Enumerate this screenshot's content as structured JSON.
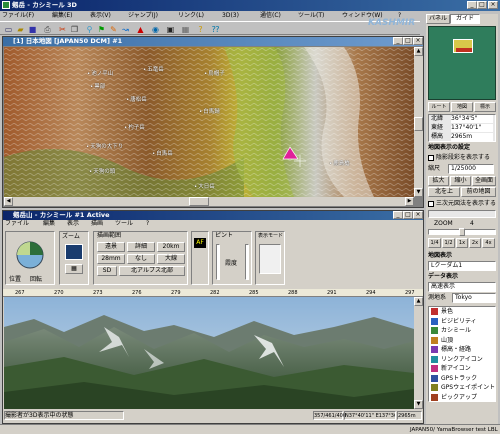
{
  "window": {
    "title": "剱岳 - カシミール 3D"
  },
  "menu": [
    "ファイル(F)",
    "編集(E)",
    "表示(V)",
    "ジャンプ(J)",
    "リンク(L)",
    "3D(3)",
    "通信(C)",
    "ツール(T)",
    "ウィンドウ(W)",
    "?"
  ],
  "brand": {
    "name": "KASHMIR 3D"
  },
  "map_window": {
    "title": "[1] 日本地図 [JAPAN50 DCM] #1",
    "places": [
      "池ノ平山",
      "五竜岳",
      "黒部",
      "唐松岳",
      "烏帽子",
      "白馬鑓",
      "杓子岳",
      "天狗の大下り",
      "白馬岳",
      "天狗の頭",
      "大日岳",
      "鹿島槍"
    ]
  },
  "scene_window": {
    "title": "剱岳山 - カシミール #1 Active",
    "menu": [
      "ファイル",
      "編集",
      "表示",
      "描画",
      "ツール",
      "?"
    ],
    "groups": {
      "view_label": "位置",
      "view2_label": "回転",
      "zoom_label": "ズーム",
      "range_label": "描画範囲",
      "buttons": [
        "遠景",
        "詳細",
        "20km",
        "28mm",
        "なし",
        "大線",
        "SD",
        "北アルプス北部"
      ],
      "mode_btn": "AF",
      "aux_btns": [
        "ピント",
        "霞度"
      ],
      "opt_label": "表示モード"
    },
    "ruler": [
      "267",
      "270",
      "273",
      "276",
      "279",
      "282",
      "285",
      "288",
      "291",
      "294",
      "297"
    ],
    "status": [
      "撮影者が3D表示中の状態",
      "357/461/400",
      "N37°40'11\" E137°36'38\"",
      "2965m"
    ]
  },
  "right_panel": {
    "tabs": [
      "パネル",
      "ガイド"
    ],
    "mode_tabs": [
      "ルート",
      "地図",
      "標示"
    ],
    "info_rows": [
      [
        "北緯",
        "36°34'5\""
      ],
      [
        "東経",
        "137°40'1\""
      ],
      [
        "標高",
        "2965m"
      ]
    ],
    "section1": "地図表示の設定",
    "check1": "陰影段彩を表示する",
    "scale_label": "縮尺",
    "scale_value": "1/25000",
    "btns1": [
      "拡大",
      "縮小",
      "全画面"
    ],
    "btns2": [
      "北を上",
      "前の地図"
    ],
    "check2": "三次元図法を表示する",
    "zoom_label": "ZOOM",
    "zoom_value": "4",
    "zoom_btns": [
      "1/4",
      "1/2",
      "1x",
      "2x",
      "4x"
    ],
    "section2": "地図表示",
    "select1": "Lクーダム1",
    "section3": "データ表示",
    "select2": "高速表示",
    "select3": "Tokyo",
    "section4": "測地系",
    "layers": [
      "景色",
      "ビジビリティ",
      "カシミール",
      "山頂",
      "標高・経路",
      "リンクアイコン",
      "新アイコン",
      "GPSトラック",
      "GPSウェイポイント",
      "ピックアップ"
    ],
    "status": "JAPAN50/ YamaBrowser test LBL"
  },
  "colors": {
    "title_active": "#0a246a",
    "panel_green": "#2f7d5c",
    "tent": "#e0209a"
  }
}
